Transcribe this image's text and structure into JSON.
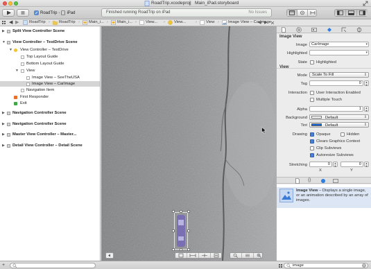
{
  "window": {
    "project_file": "RoadTrip.xcodeproj",
    "storyboard_file": "Main_iPad.storyboard"
  },
  "toolbar": {
    "scheme": "RoadTrip",
    "device": "iPad",
    "status": "Finished running RoadTrip on iPad",
    "issues": "No Issues"
  },
  "jumpbar": {
    "crumbs": [
      "RoadTrip",
      "RoadTrip",
      "Main_i...",
      "Main_i...",
      "View...",
      "View...",
      "View",
      "Image View – CarImage"
    ]
  },
  "navigator": {
    "rows": [
      {
        "label": "Split View Controller Scene",
        "bold": true
      },
      {
        "label": "View Controller – TestDrive Scene",
        "bold": true
      },
      {
        "label": "View Controller – TestDrive",
        "bold": false
      },
      {
        "label": "Top Layout Guide",
        "bold": false
      },
      {
        "label": "Bottom Layout Guide",
        "bold": false
      },
      {
        "label": "View",
        "bold": false
      },
      {
        "label": "Image View – SeeTheUSA",
        "bold": false
      },
      {
        "label": "Image View – CarImage",
        "bold": false
      },
      {
        "label": "Navigation Item",
        "bold": false
      },
      {
        "label": "First Responder",
        "bold": false
      },
      {
        "label": "Exit",
        "bold": false
      },
      {
        "label": "Navigation Controller Scene",
        "bold": true
      },
      {
        "label": "Navigation Controller Scene",
        "bold": true
      },
      {
        "label": "Master View Controller – Master...",
        "bold": true
      },
      {
        "label": "Detail View Controller – Detail Scene",
        "bold": true
      }
    ]
  },
  "inspector": {
    "image_view": {
      "header": "Image View",
      "image_label": "Image",
      "image_value": "CarImage",
      "highlighted_label": "Highlighted",
      "state_label": "State",
      "state_checkbox": "Highlighted"
    },
    "view": {
      "header": "View",
      "mode_label": "Mode",
      "mode_value": "Scale To Fill",
      "tag_label": "Tag",
      "tag_value": "0",
      "interaction_label": "Interaction",
      "user_interaction": "User Interaction Enabled",
      "multiple_touch": "Multiple Touch",
      "alpha_label": "Alpha",
      "alpha_value": "1",
      "background_label": "Background",
      "background_value": "Default",
      "tint_label": "Tint",
      "tint_value": "Default",
      "drawing_label": "Drawing",
      "opaque": "Opaque",
      "hidden": "Hidden",
      "clears_graphics": "Clears Graphics Context",
      "clip_subviews": "Clip Subviews",
      "autoresize_subviews": "Autoresize Subviews",
      "stretching_label": "Stretching",
      "stretch_x_value": "0",
      "stretch_y_value": "0",
      "x_label": "X",
      "y_label": "Y"
    },
    "library": {
      "title": "Image View",
      "description": " – Displays a single image, or an animation described by an array of images."
    }
  },
  "bottom": {
    "library_search": "image"
  },
  "colors": {
    "selection": "#d5d5d5",
    "checkbox_on": "#4b7fd1",
    "tint_swatch": "#1f6fd6",
    "activity_bg": "#e8ebe8"
  },
  "icons": [
    "apple-icon",
    "run-icon",
    "stop-icon",
    "folder-icon",
    "grid-icon",
    "back-icon",
    "forward-icon",
    "storyboard-icon",
    "vc-icon",
    "view-icon",
    "first-responder-icon",
    "exit-icon",
    "zoom-icon",
    "file-inspector-icon",
    "help-icon",
    "identity-icon",
    "attributes-icon",
    "size-icon",
    "connections-icon",
    "search-icon"
  ]
}
